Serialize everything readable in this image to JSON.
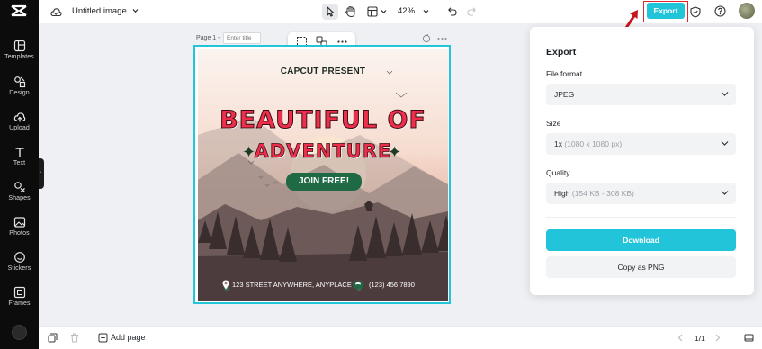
{
  "app": {
    "document_title": "Untitled image",
    "zoom": "42%"
  },
  "sidebar": {
    "items": [
      {
        "label": "Templates",
        "icon": "templates-icon"
      },
      {
        "label": "Design",
        "icon": "design-icon"
      },
      {
        "label": "Upload",
        "icon": "upload-icon"
      },
      {
        "label": "Text",
        "icon": "text-icon"
      },
      {
        "label": "Shapes",
        "icon": "shapes-icon"
      },
      {
        "label": "Photos",
        "icon": "photos-icon"
      },
      {
        "label": "Stickers",
        "icon": "stickers-icon"
      },
      {
        "label": "Frames",
        "icon": "frames-icon"
      }
    ]
  },
  "toolbar": {
    "export_label": "Export"
  },
  "canvas": {
    "page_label": "Page 1 -",
    "title_placeholder": "Enter title"
  },
  "design": {
    "present": "CAPCUT PRESENT",
    "headline_1": "BEAUTIFUL OF",
    "headline_2": "ADVENTURE",
    "cta": "JOIN FREE!",
    "address": "123 STREET ANYWHERE, ANYPLACE",
    "phone": "(123) 456 7890"
  },
  "export_panel": {
    "title": "Export",
    "file_format_label": "File format",
    "file_format_value": "JPEG",
    "size_label": "Size",
    "size_value": "1x",
    "size_hint": "(1080 x 1080 px)",
    "quality_label": "Quality",
    "quality_value": "High",
    "quality_hint": "(154 KB - 308 KB)",
    "download_label": "Download",
    "copy_label": "Copy as PNG"
  },
  "bottombar": {
    "add_page_label": "Add page",
    "pager": "1/1"
  },
  "colors": {
    "accent": "#21c4d9",
    "highlight": "#e0262a",
    "headline": "#ed2f4c",
    "cta": "#1f6a45"
  }
}
